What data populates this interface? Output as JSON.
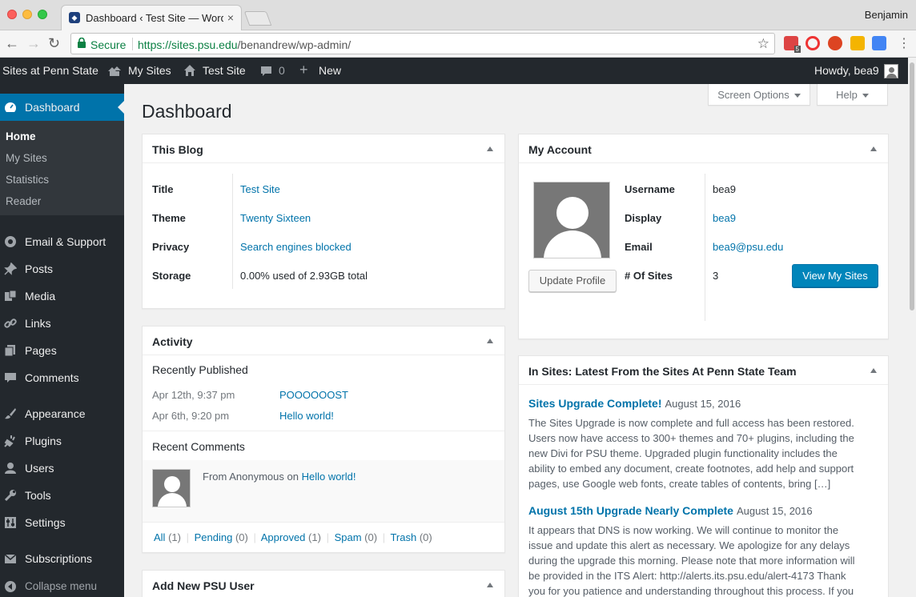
{
  "browser": {
    "tab_title": "Dashboard ‹ Test Site — WordPress",
    "tab_close": "×",
    "profile_name": "Benjamin",
    "secure_label": "Secure",
    "url_scheme_host": "https://sites.psu.edu",
    "url_path": "/benandrew/wp-admin/",
    "extension_badge": "5",
    "colors": {
      "secure_green": "#0b8043"
    }
  },
  "adminbar": {
    "site_network": "Sites at Penn State",
    "my_sites": "My Sites",
    "test_site": "Test Site",
    "comments_count": "0",
    "new_label": "New",
    "howdy": "Howdy, bea9"
  },
  "sidebar": {
    "dashboard": "Dashboard",
    "submenu": [
      "Home",
      "My Sites",
      "Statistics",
      "Reader"
    ],
    "items": [
      "Email & Support",
      "Posts",
      "Media",
      "Links",
      "Pages",
      "Comments",
      "Appearance",
      "Plugins",
      "Users",
      "Tools",
      "Settings",
      "Subscriptions"
    ],
    "collapse": "Collapse menu",
    "colors": {
      "bg": "#23282d",
      "active": "#0073aa"
    }
  },
  "page": {
    "title": "Dashboard",
    "screen_options": "Screen Options",
    "help": "Help"
  },
  "this_blog": {
    "heading": "This Blog",
    "rows": [
      {
        "label": "Title",
        "value": "Test Site"
      },
      {
        "label": "Theme",
        "value": "Twenty Sixteen"
      },
      {
        "label": "Privacy",
        "value": "Search engines blocked"
      },
      {
        "label": "Storage",
        "value": "0.00% used of 2.93GB total"
      }
    ]
  },
  "my_account": {
    "heading": "My Account",
    "update_profile": "Update Profile",
    "view_my_sites": "View My Sites",
    "rows": [
      {
        "label": "Username",
        "value": "bea9"
      },
      {
        "label": "Display",
        "value": "bea9"
      },
      {
        "label": "Email",
        "value": "bea9@psu.edu"
      },
      {
        "label": "# Of Sites",
        "value": "3"
      }
    ]
  },
  "activity": {
    "heading": "Activity",
    "recently_published": "Recently Published",
    "posts": [
      {
        "date": "Apr 12th, 9:37 pm",
        "title": "POOOOOOST"
      },
      {
        "date": "Apr 6th, 9:20 pm",
        "title": "Hello world!"
      }
    ],
    "recent_comments": "Recent Comments",
    "comment_prefix": "From Anonymous on",
    "comment_post": "Hello world!",
    "filters": [
      {
        "name": "All",
        "count": "(1)"
      },
      {
        "name": "Pending",
        "count": "(0)"
      },
      {
        "name": "Approved",
        "count": "(1)"
      },
      {
        "name": "Spam",
        "count": "(0)"
      },
      {
        "name": "Trash",
        "count": "(0)"
      }
    ]
  },
  "add_user": {
    "heading": "Add New PSU User"
  },
  "news": {
    "heading": "In Sites: Latest From the Sites At Penn State Team",
    "items": [
      {
        "title": "Sites Upgrade Complete!",
        "date": "August 15, 2016",
        "lines": [
          "The Sites Upgrade is now complete and full access has been restored.",
          "Users now have access to 300+ themes and 70+ plugins, including the",
          "new Divi for PSU theme. Upgraded plugin functionality includes the",
          "ability to embed any document, create footnotes, add help and support",
          "pages, use Google web fonts, create tables of contents, bring […]"
        ]
      },
      {
        "title": "August 15th Upgrade Nearly Complete",
        "date": "August 15, 2016",
        "lines": [
          "It appears that DNS is now working. We will continue to monitor the",
          "issue and update this alert as necessary. We apologize for any delays",
          "during the upgrade this morning. Please note that more information will",
          "be provided in the ITS Alert: http://alerts.its.psu.edu/alert-4173 Thank",
          "you for you patience and understanding throughout this process. If you"
        ]
      }
    ]
  }
}
